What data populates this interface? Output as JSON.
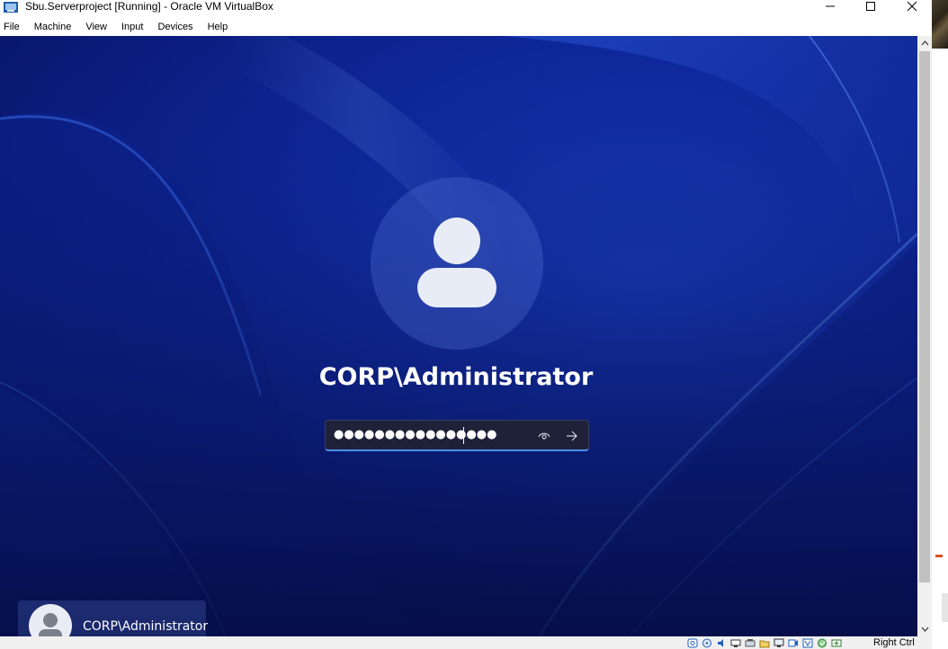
{
  "window": {
    "title": "Sbu.Serverproject  [Running] - Oracle VM VirtualBox",
    "icon": "virtualbox-icon"
  },
  "menu": {
    "items": [
      "File",
      "Machine",
      "View",
      "Input",
      "Devices",
      "Help"
    ]
  },
  "login": {
    "username": "CORP\\Administrator",
    "password_masked": "●●●●●●●●●●●●●●●●",
    "reveal_icon": "eye-icon",
    "submit_icon": "arrow-right-icon"
  },
  "user_tiles": [
    {
      "label": "CORP\\Administrator",
      "icon": "user-avatar-icon"
    }
  ],
  "statusbar": {
    "icons": [
      "hard-disk-icon",
      "optical-drive-icon",
      "audio-icon",
      "network-icon",
      "usb-icon",
      "shared-folders-icon",
      "display-icon",
      "recording-icon",
      "vt-x-icon",
      "mouse-integration-icon",
      "guest-additions-icon"
    ],
    "host_key": "Right Ctrl"
  },
  "colors": {
    "wallpaper_base": "#0f2aa0",
    "password_focus_border": "#4a8fe8",
    "text_on_wallpaper": "#ffffff"
  }
}
